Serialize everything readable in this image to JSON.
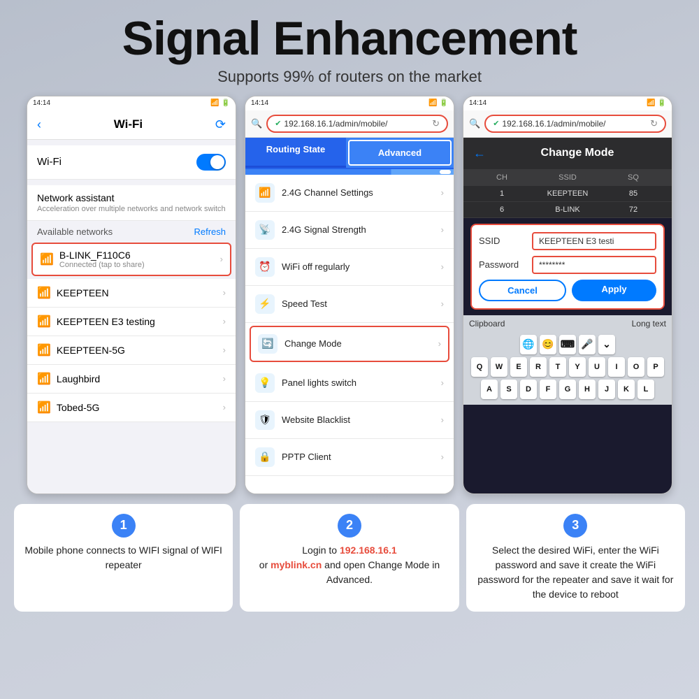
{
  "header": {
    "title": "Signal Enhancement",
    "subtitle": "Supports 99% of routers on the market"
  },
  "phone1": {
    "statusBar": "14:14",
    "wifiTitle": "Wi-Fi",
    "wifiLabel": "Wi-Fi",
    "networkAssistant": "Network assistant",
    "networkAssistantSub": "Acceleration over multiple networks and network switch",
    "availableNetworks": "Available networks",
    "refresh": "Refresh",
    "connectedNetwork": "B-LINK_F110C6",
    "connectedSub": "Connected (tap to share)",
    "networks": [
      {
        "name": "KEEPTEEN"
      },
      {
        "name": "KEEPTEEN E3 testing"
      },
      {
        "name": "KEEPTEEN-5G"
      },
      {
        "name": "Laughbird"
      },
      {
        "name": "Tobed-5G"
      }
    ]
  },
  "phone2": {
    "statusBar": "14:14",
    "url": "192.168.16.1/admin/mobile/",
    "tab1": "Routing State",
    "tab2": "Advanced",
    "menuItems": [
      {
        "icon": "📶",
        "text": "2.4G Channel Settings"
      },
      {
        "icon": "📡",
        "text": "2.4G Signal Strength"
      },
      {
        "icon": "⏰",
        "text": "WiFi off regularly"
      },
      {
        "icon": "⚡",
        "text": "Speed Test"
      },
      {
        "icon": "🔄",
        "text": "Change Mode"
      },
      {
        "icon": "💡",
        "text": "Panel lights switch"
      },
      {
        "icon": "🛡",
        "text": "Website Blacklist"
      },
      {
        "icon": "🔒",
        "text": "PPTP Client"
      }
    ]
  },
  "phone3": {
    "statusBar": "14:14",
    "url": "192.168.16.1/admin/mobile/",
    "changeMode": "Change Mode",
    "tableHeaders": [
      "CH",
      "SSID",
      "SQ"
    ],
    "tableRows": [
      [
        "1",
        "KEEPTEEN",
        "85"
      ],
      [
        "6",
        "B-LINK",
        "72"
      ]
    ],
    "ssidLabel": "SSID",
    "ssidValue": "KEEPTEEN E3 testi",
    "passwordLabel": "Password",
    "passwordValue": "********",
    "cancelBtn": "Cancel",
    "applyBtn": "Apply",
    "clipboard": "Clipboard",
    "longText": "Long text",
    "keyboardRows": [
      [
        "Q",
        "W",
        "E",
        "R",
        "T",
        "Y",
        "U",
        "I",
        "O",
        "P"
      ],
      [
        "A",
        "S",
        "D",
        "F",
        "G",
        "H",
        "J",
        "K",
        "L"
      ]
    ]
  },
  "steps": [
    {
      "number": "1",
      "text": "Mobile phone connects to WIFI signal of WIFI repeater"
    },
    {
      "number": "2",
      "text": "Login to 192.168.16.1 or myblink.cn and open Change Mode in Advanced.",
      "highlight1": "192.168.16.1",
      "highlight2": "myblink.cn"
    },
    {
      "number": "3",
      "text": "Select the desired WiFi, enter the WiFi password and save it create the WiFi password for the repeater and save it wait for the device to reboot"
    }
  ]
}
